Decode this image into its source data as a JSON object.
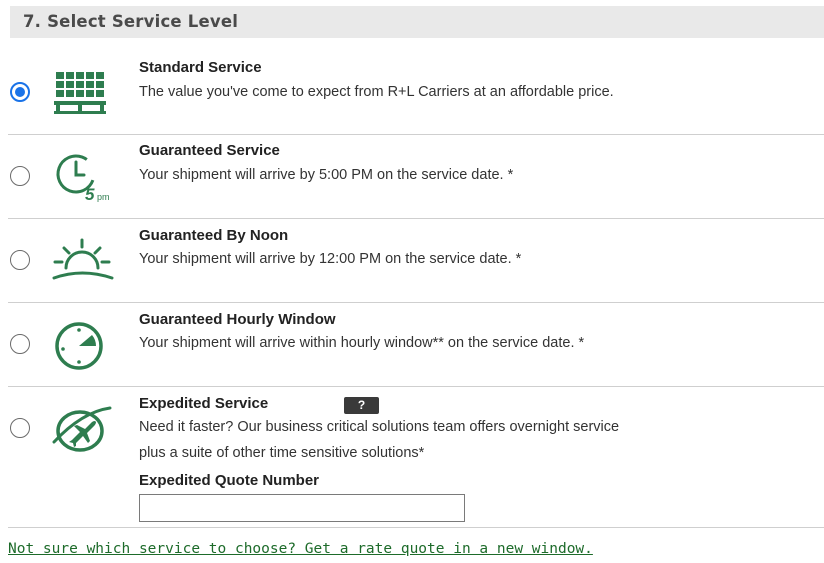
{
  "section": {
    "title": "7. Select Service Level"
  },
  "options": [
    {
      "title": "Standard Service",
      "description": "The value you've come to expect from R+L Carriers at an affordable price.",
      "selected": true,
      "icon": "pallet-icon"
    },
    {
      "title": "Guaranteed Service",
      "description": "Your shipment will arrive by 5:00 PM on the service date. *",
      "selected": false,
      "icon": "clock-5pm-icon",
      "icon_label": "5",
      "icon_sublabel": "pm"
    },
    {
      "title": "Guaranteed By Noon",
      "description": "Your shipment will arrive by 12:00 PM on the service date. *",
      "selected": false,
      "icon": "sun-horizon-icon"
    },
    {
      "title": "Guaranteed Hourly Window",
      "description": "Your shipment will arrive within hourly window** on the service date. *",
      "selected": false,
      "icon": "clock-window-icon"
    },
    {
      "title": "Expedited Service",
      "description_line1": "Need it faster? Our business critical solutions team offers overnight service",
      "description_line2": "plus a suite of other time sensitive solutions*",
      "selected": false,
      "icon": "globe-plane-icon",
      "help_label": "?",
      "quote_label": "Expedited Quote Number",
      "quote_value": ""
    }
  ],
  "footer": {
    "link_text": "Not sure which service to choose? Get a rate quote in a new window."
  },
  "colors": {
    "accent": "#1a73e8",
    "icon_green": "#2e7d4f",
    "link": "#1d6b2a",
    "header_bg": "#e9e9e9"
  }
}
